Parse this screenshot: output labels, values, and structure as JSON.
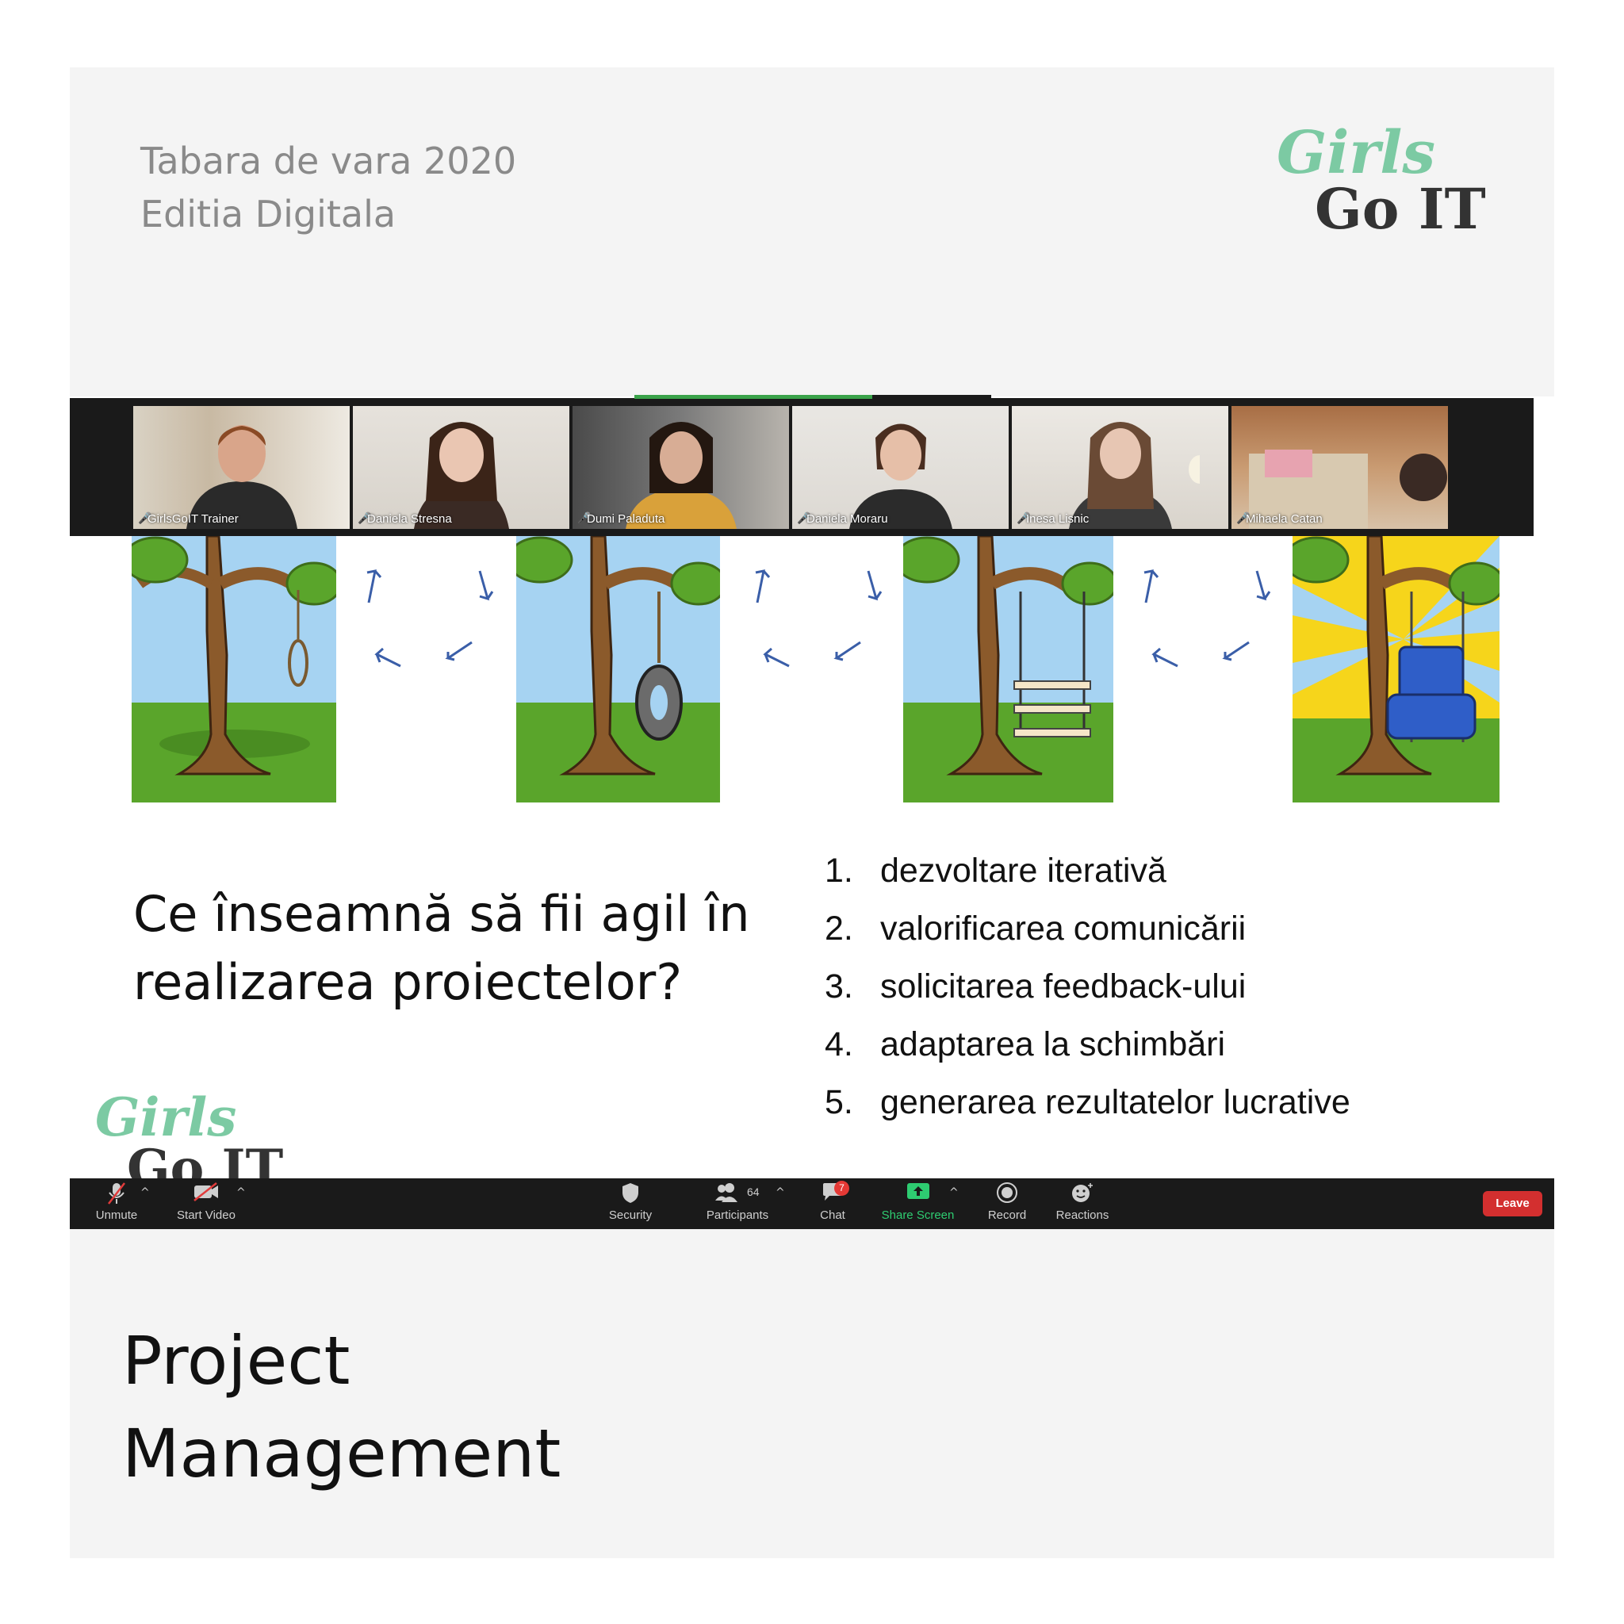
{
  "header": {
    "line1": "Tabara de vara 2020",
    "line2": "Editia Digitala"
  },
  "logo": {
    "girls": "Girls",
    "goit": "Go IT"
  },
  "participants": [
    {
      "name": "GirlsGoIT Trainer"
    },
    {
      "name": "Daniela Stresna"
    },
    {
      "name": "Dumi Paladuta"
    },
    {
      "name": "Daniela Moraru"
    },
    {
      "name": "Inesa Lisnic"
    },
    {
      "name": "Mihaela Catan"
    }
  ],
  "slide": {
    "question_line1": "Ce înseamnă să fii agil în",
    "question_line2": "realizarea proiectelor?",
    "items": [
      {
        "num": "1.",
        "text": "dezvoltare iterativă"
      },
      {
        "num": "2.",
        "text": "valorificarea comunicării"
      },
      {
        "num": "3.",
        "text": "solicitarea feedback-ului"
      },
      {
        "num": "4.",
        "text": "adaptarea la schimbări"
      },
      {
        "num": "5.",
        "text": "generarea rezultatelor lucrative"
      }
    ]
  },
  "toolbar": {
    "unmute": "Unmute",
    "start_video": "Start Video",
    "security": "Security",
    "participants": "Participants",
    "participants_count": "64",
    "chat": "Chat",
    "chat_badge": "7",
    "share_screen": "Share Screen",
    "record": "Record",
    "reactions": "Reactions",
    "leave": "Leave"
  },
  "colors": {
    "leave": "#d32f2f",
    "share_screen": "#2ecc71",
    "logo_green": "#7ccaa3",
    "active_speaker": "#3aa34a"
  },
  "caption": {
    "line1": "Project",
    "line2": "Management"
  }
}
